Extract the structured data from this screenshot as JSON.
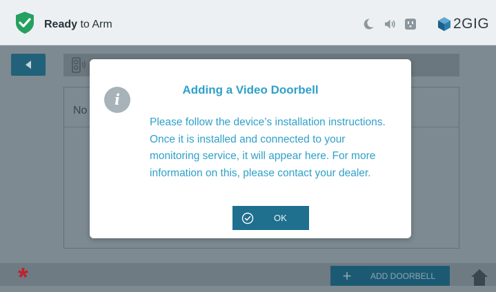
{
  "header": {
    "status_bold": "Ready",
    "status_rest": " to Arm",
    "logo_text": "2GIG",
    "icons": [
      "shield-check-icon",
      "moon-icon",
      "speaker-icon",
      "outlet-icon"
    ]
  },
  "panel": {
    "list_text_visible": "No"
  },
  "modal": {
    "title": "Adding a Video Doorbell",
    "message": "Please follow the device’s installation instructions. Once it is installed and connected to your monitoring service, it will appear here. For more information on this, please contact your dealer.",
    "ok_label": "OK"
  },
  "footer": {
    "add_label": "ADD DOORBELL",
    "plus_symbol": "+",
    "asterisk_symbol": "*"
  },
  "colors": {
    "accent": "#2ea0c9",
    "shield": "#25a060",
    "button": "#1f6f8f",
    "alert": "#c0212e"
  }
}
